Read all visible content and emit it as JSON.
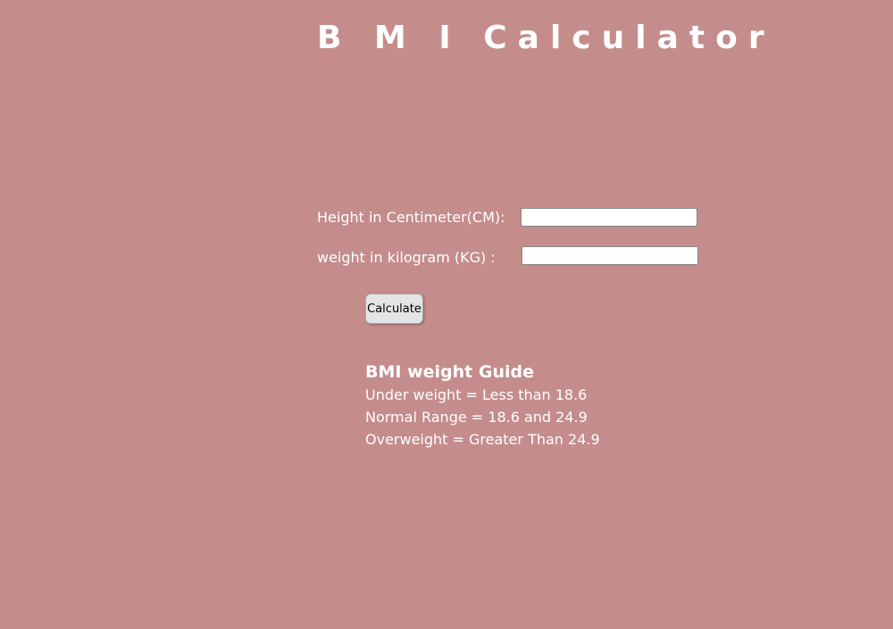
{
  "title": "B M I Calculator",
  "form": {
    "height_label": "Height in Centimeter(CM):",
    "height_value": "",
    "weight_label": "weight in kilogram (KG) :",
    "weight_value": "",
    "calculate_label": "Calculate"
  },
  "guide": {
    "heading": "BMI weight Guide",
    "lines": [
      "Under weight = Less than 18.6",
      "Normal Range = 18.6 and 24.9",
      "Overweight = Greater Than 24.9"
    ]
  }
}
